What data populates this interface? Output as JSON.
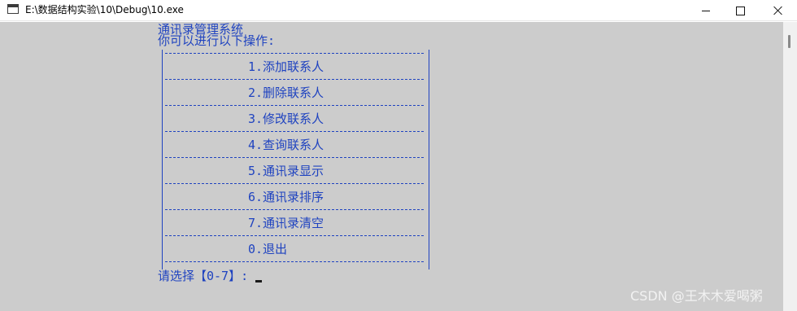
{
  "window": {
    "title": "E:\\数据结构实验\\10\\Debug\\10.exe",
    "controls": [
      "minimize-icon",
      "maximize-icon",
      "close-icon"
    ]
  },
  "console": {
    "header_line1": "通讯录管理系统",
    "header_line2": "你可以进行以下操作:",
    "menu_items": [
      "1.添加联系人",
      "2.删除联系人",
      "3.修改联系人",
      "4.查询联系人",
      "5.通讯录显示",
      "6.通讯录排序",
      "7.通讯录清空",
      "0.退出"
    ],
    "prompt": "请选择【0-7】:"
  },
  "watermark": "CSDN @王木木爱喝粥",
  "colors": {
    "console_bg": "#cccccc",
    "console_text": "#1f43c0",
    "titlebar_bg": "#ffffff"
  }
}
